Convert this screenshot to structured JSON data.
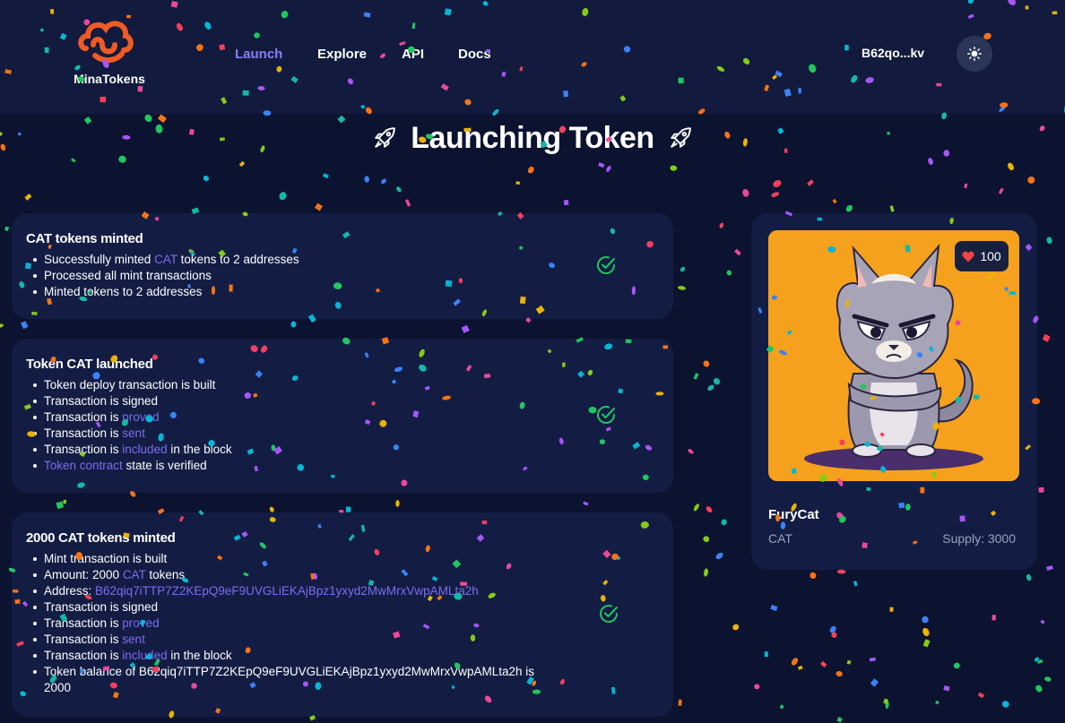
{
  "brand": {
    "name": "MinaTokens",
    "logo_color": "#f15a24"
  },
  "nav": {
    "items": [
      {
        "label": "Launch",
        "active": true
      },
      {
        "label": "Explore",
        "active": false
      },
      {
        "label": "API",
        "active": false
      },
      {
        "label": "Docs",
        "active": false
      }
    ]
  },
  "wallet": {
    "address": "B62qo...kv"
  },
  "theme_toggle": {
    "icon": "sun-icon"
  },
  "page": {
    "title": "Launching Token",
    "title_icon": "rocket-icon"
  },
  "cards": [
    {
      "title": "CAT tokens minted",
      "status_icon": "check-circle-icon",
      "items": [
        {
          "parts": [
            {
              "text": "Successfully minted "
            },
            {
              "text": "CAT",
              "hl": true
            },
            {
              "text": " tokens to 2 addresses"
            }
          ]
        },
        {
          "parts": [
            {
              "text": "Processed all mint transactions"
            }
          ]
        },
        {
          "parts": [
            {
              "text": "Minted tokens to 2 addresses"
            }
          ]
        }
      ]
    },
    {
      "title": "Token CAT launched",
      "status_icon": "check-circle-icon",
      "items": [
        {
          "parts": [
            {
              "text": "Token deploy transaction is built"
            }
          ]
        },
        {
          "parts": [
            {
              "text": "Transaction is signed"
            }
          ]
        },
        {
          "parts": [
            {
              "text": "Transaction is "
            },
            {
              "text": "proved",
              "hl": true
            }
          ]
        },
        {
          "parts": [
            {
              "text": "Transaction is "
            },
            {
              "text": "sent",
              "hl": true
            }
          ]
        },
        {
          "parts": [
            {
              "text": "Transaction is "
            },
            {
              "text": "included",
              "hl": true
            },
            {
              "text": " in the block"
            }
          ]
        },
        {
          "parts": [
            {
              "text": "Token contract",
              "hl": true
            },
            {
              "text": " state is verified"
            }
          ]
        }
      ]
    },
    {
      "title": "2000 CAT tokens minted",
      "status_icon": "check-circle-icon",
      "items": [
        {
          "parts": [
            {
              "text": "Mint transaction is built"
            }
          ]
        },
        {
          "parts": [
            {
              "text": "Amount: 2000 "
            },
            {
              "text": "CAT",
              "hl": true
            },
            {
              "text": " tokens"
            }
          ]
        },
        {
          "parts": [
            {
              "text": "Address: "
            },
            {
              "text": "B62qiq7iTTP7Z2KEpQ9eF9UVGLiEKAjBpz1yxyd2MwMrxVwpAMLta2h",
              "hl": true
            }
          ]
        },
        {
          "parts": [
            {
              "text": "Transaction is signed"
            }
          ]
        },
        {
          "parts": [
            {
              "text": "Transaction is "
            },
            {
              "text": "proved",
              "hl": true
            }
          ]
        },
        {
          "parts": [
            {
              "text": "Transaction is "
            },
            {
              "text": "sent",
              "hl": true
            }
          ]
        },
        {
          "parts": [
            {
              "text": "Transaction is "
            },
            {
              "text": "included",
              "hl": true
            },
            {
              "text": " in the block"
            }
          ]
        },
        {
          "parts": [
            {
              "text": "Token balance of B62qiq7iTTP7Z2KEpQ9eF9UVGLiEKAjBpz1yxyd2MwMrxVwpAMLta2h is 2000"
            }
          ]
        }
      ]
    }
  ],
  "token": {
    "name": "FuryCat",
    "symbol": "CAT",
    "supply": "Supply: 3000",
    "likes": "100",
    "image": "angry-cat-illustration",
    "image_bg": "#f6a11d"
  },
  "colors": {
    "background": "#0b1330",
    "card": "#131d44",
    "accent": "#7a6cf0",
    "success": "#22c55e"
  }
}
